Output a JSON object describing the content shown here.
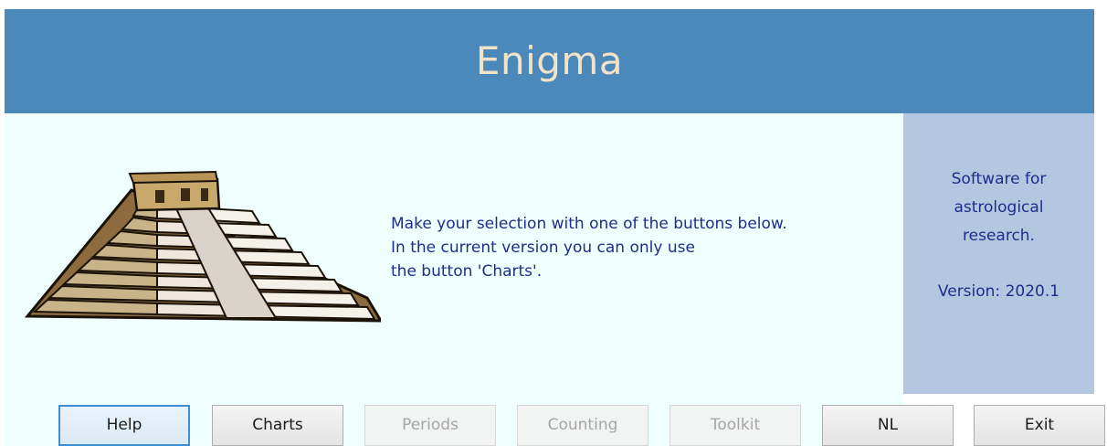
{
  "header": {
    "title": "Enigma"
  },
  "main": {
    "message_lines": [
      "Make your selection with one of the buttons below.",
      "In the current version you can only use",
      "the button 'Charts'."
    ],
    "image": "pyramid-illustration"
  },
  "side_panel": {
    "lines": [
      "Software for",
      "astrological",
      "research.",
      "Version: 2020.1"
    ]
  },
  "buttons": [
    {
      "label": "Help",
      "state": "focused"
    },
    {
      "label": "Charts",
      "state": "enabled"
    },
    {
      "label": "Periods",
      "state": "disabled"
    },
    {
      "label": "Counting",
      "state": "disabled"
    },
    {
      "label": "Toolkit",
      "state": "disabled"
    },
    {
      "label": "NL",
      "state": "enabled"
    },
    {
      "label": "Exit",
      "state": "enabled"
    }
  ],
  "colors": {
    "header_bg": "#4a89b9",
    "title_text": "#f3e3c6",
    "content_bg": "#eefffe",
    "side_bg": "#b3c7e0",
    "body_text": "#1f2d8a"
  }
}
